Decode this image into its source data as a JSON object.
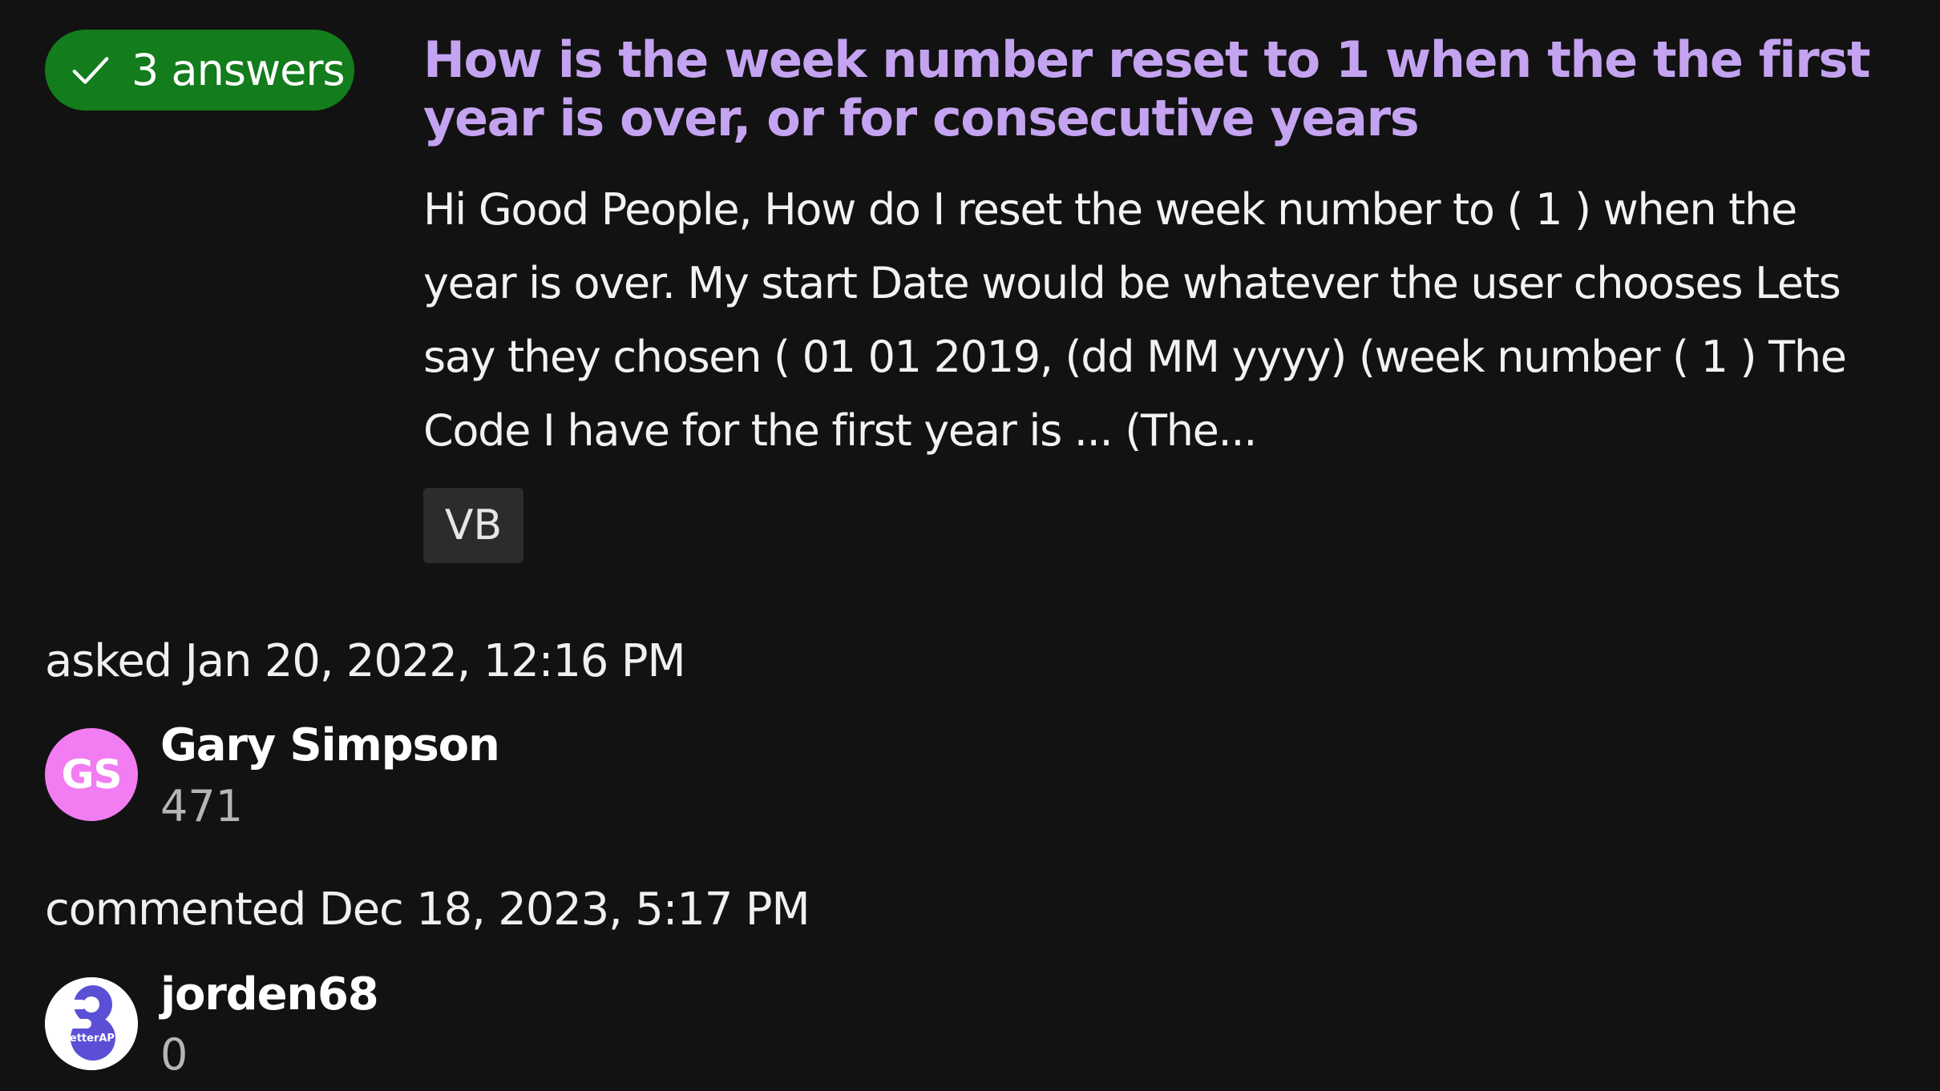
{
  "question": {
    "answers_badge": "3 answers",
    "title": "How is the week number reset to 1 when the the first year is over, or for consecutive years",
    "excerpt": "Hi Good People, How do I reset the week number to ( 1 ) when the year is over. My start Date would be whatever the user chooses Lets say they chosen ( 01 01 2019, (dd MM yyyy) (week number ( 1 ) The Code I have for the first year is ... (The...",
    "tags": [
      "VB"
    ]
  },
  "asked": {
    "text": "asked Jan 20, 2022, 12:16 PM",
    "user": {
      "initials": "GS",
      "name": "Gary Simpson",
      "reputation": "471",
      "avatar_color": "#f27cf2"
    }
  },
  "commented": {
    "text": "commented Dec 18, 2023, 5:17 PM",
    "user": {
      "name": "jorden68",
      "reputation": "0",
      "avatar_logo_text": "BetterAPK",
      "avatar_color": "#5b4fd6"
    }
  },
  "colors": {
    "background": "#121212",
    "badge_green": "#137c1c",
    "title_purple": "#c4a3f0",
    "tag_bg": "#2c2c2c"
  }
}
